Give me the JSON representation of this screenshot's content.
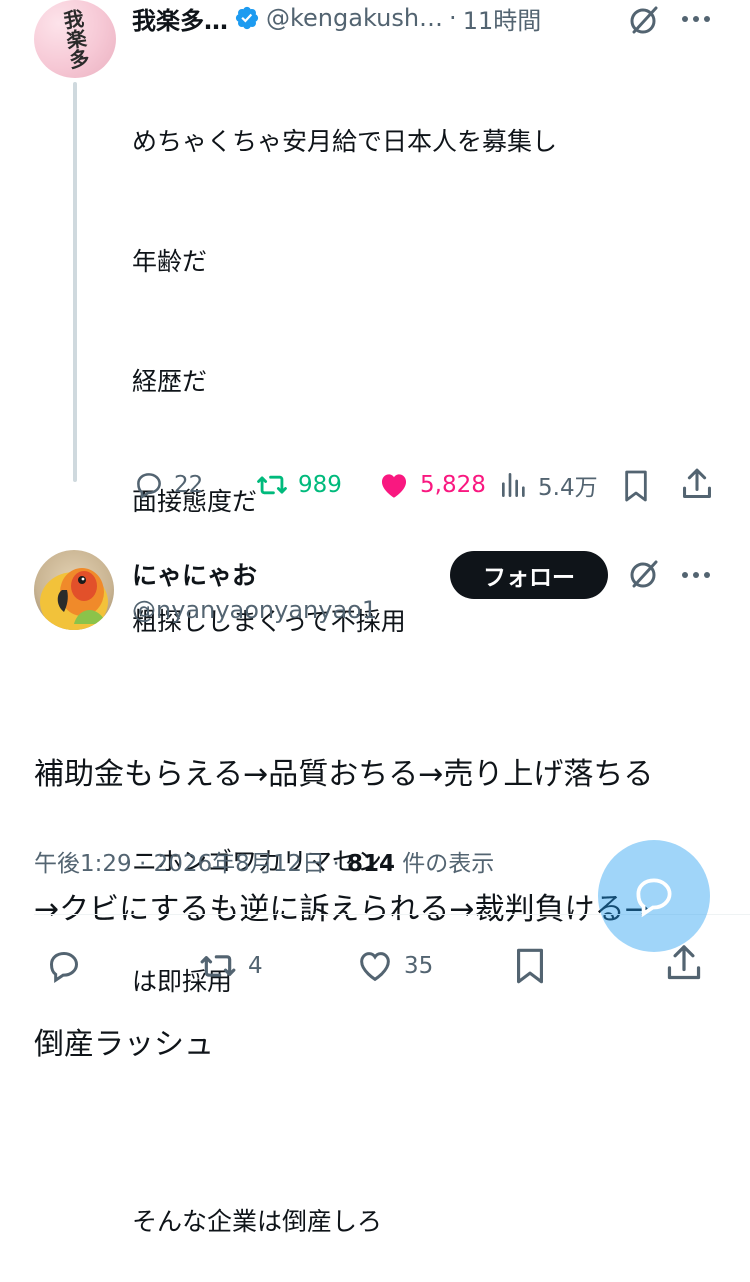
{
  "parent_tweet": {
    "avatar_text": "我楽多",
    "name": "我楽多…",
    "handle": "@kengakush…",
    "separator": "·",
    "time": "11時間",
    "text_lines": [
      "めちゃくちゃ安月給で日本人を募集し",
      "年齢だ",
      "経歴だ",
      "面接態度だ",
      "粗探ししまくって不採用",
      "",
      "ニホンゴワカリマセン",
      "は即採用",
      "",
      "そんな企業は倒産しろ"
    ],
    "replies": "22",
    "retweets": "989",
    "likes": "5,828",
    "views": "5.4万"
  },
  "main_tweet": {
    "name": "にゃにゃお",
    "handle": "@nyanyaonyanyao1",
    "follow_label": "フォロー",
    "text_lines": [
      "補助金もらえる→品質おちる→売り上げ落ちる",
      "→クビにするも逆に訴えられる→裁判負ける→",
      "倒産ラッシュ"
    ],
    "time": "午後1:29",
    "date": "2026年8月12日",
    "views_count": "814",
    "views_label": "件の表示",
    "separator": "·",
    "retweets": "4",
    "likes": "35"
  },
  "colors": {
    "text": "#0f1419",
    "muted": "#536471",
    "retweet": "#00ba7c",
    "like": "#f91880",
    "verified": "#1d9bf0",
    "fab": "#1d9bf0"
  },
  "icons": [
    "verified-badge-icon",
    "grok-icon",
    "more-icon",
    "reply-icon",
    "retweet-icon",
    "heart-icon",
    "views-icon",
    "bookmark-icon",
    "share-icon",
    "compose-icon"
  ]
}
